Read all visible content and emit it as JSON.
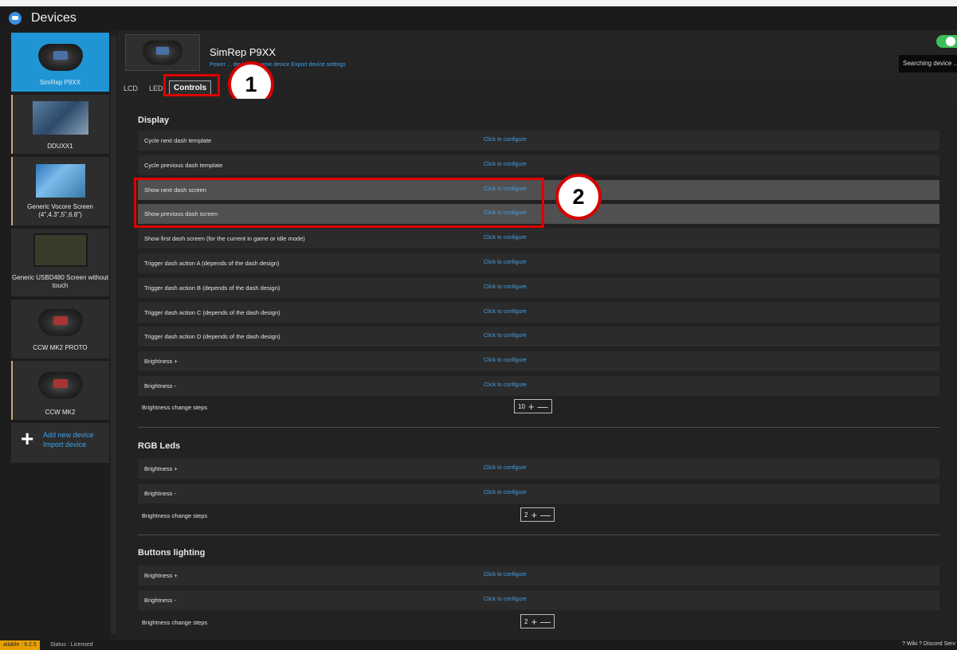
{
  "window": {
    "title": "Devices"
  },
  "sidebar": {
    "devices": [
      {
        "name": "SimRep P9XX",
        "selected": true,
        "thumb": "wheel"
      },
      {
        "name": "DDUXX1",
        "selected": false,
        "thumb": "screen"
      },
      {
        "name": "Generic Vocore Screen (4\",4.3\",5\",6.8\")",
        "selected": false,
        "thumb": "vocore"
      },
      {
        "name": "Generic USBD480 Screen without touch",
        "selected": false,
        "thumb": "lcd"
      },
      {
        "name": "CCW MK2 PROTO",
        "selected": false,
        "thumb": "wheel-red"
      },
      {
        "name": "CCW MK2",
        "selected": false,
        "thumb": "wheel-red"
      }
    ],
    "add_new": "Add new device",
    "import": "Import device"
  },
  "header": {
    "device_name": "SimRep P9XX",
    "links": "Power ... device  Rename device  Export device settings",
    "searching": "Searching device ..."
  },
  "tabs": [
    "LCD",
    "LED",
    "Controls"
  ],
  "active_tab": "Controls",
  "callouts": [
    "1",
    "2"
  ],
  "configure_label": "Click to configure",
  "sections": {
    "display": {
      "title": "Display",
      "rows": [
        "Cycle next dash template",
        "Cycle previous dash template",
        "Show next dash screen",
        "Show previous dash screen",
        "Show first dash screen (for the current in game or idle mode)",
        "Trigger dash action A (depends of the dash design)",
        "Trigger dash action B (depends of the dash design)",
        "Trigger dash action C (depends of the dash design)",
        "Trigger dash action D (depends of the dash design)",
        "Brightness +",
        "Brightness -"
      ],
      "steps_label": "Brightness change steps",
      "steps_value": "10"
    },
    "rgb": {
      "title": "RGB Leds",
      "rows": [
        "Brightness +",
        "Brightness -"
      ],
      "steps_label": "Brightness change steps",
      "steps_value": "2"
    },
    "buttons": {
      "title": "Buttons lighting",
      "rows": [
        "Brightness +",
        "Brightness -"
      ],
      "steps_label": "Brightness change steps",
      "steps_value": "2"
    }
  },
  "statusbar": {
    "available": "ailable : 9.2.5",
    "status": "Status : Licensed",
    "right": "? Wiki   ? Discord Serv"
  },
  "colors": {
    "accent": "#1f95d6",
    "link": "#3fa0ea",
    "callout_red": "#d40000"
  }
}
